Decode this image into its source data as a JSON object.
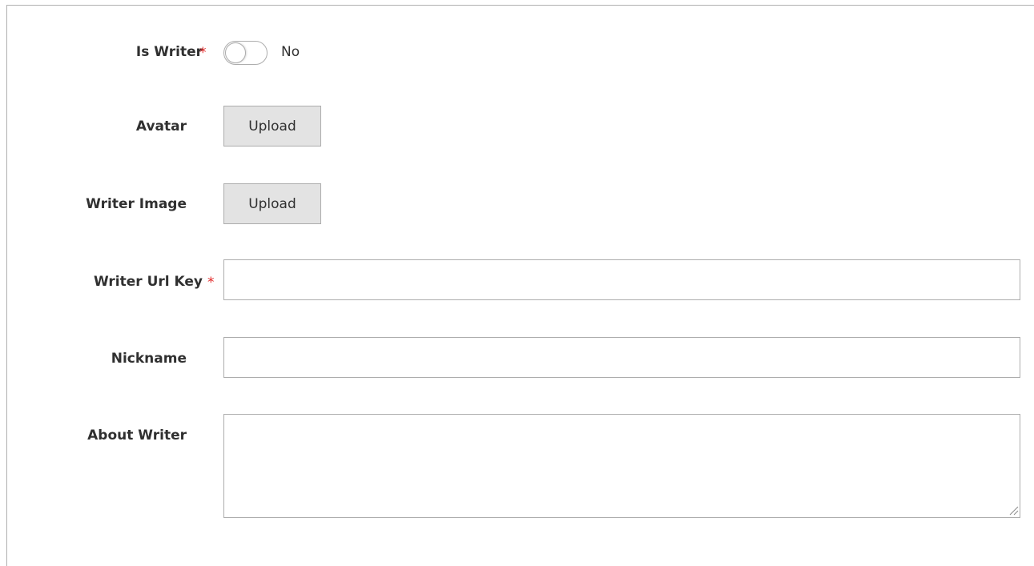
{
  "form": {
    "is_writer": {
      "label": "Is Writer",
      "required_mark": "*",
      "value_text": "No",
      "checked": false
    },
    "avatar": {
      "label": "Avatar",
      "button_label": "Upload"
    },
    "writer_image": {
      "label": "Writer Image",
      "button_label": "Upload"
    },
    "writer_url_key": {
      "label": "Writer Url Key",
      "required_mark": "*",
      "value": ""
    },
    "nickname": {
      "label": "Nickname",
      "value": ""
    },
    "about_writer": {
      "label": "About Writer",
      "value": ""
    }
  },
  "colors": {
    "required": "#e22626",
    "border": "#adadad",
    "button_bg": "#e3e3e3",
    "label_text": "#303030"
  }
}
